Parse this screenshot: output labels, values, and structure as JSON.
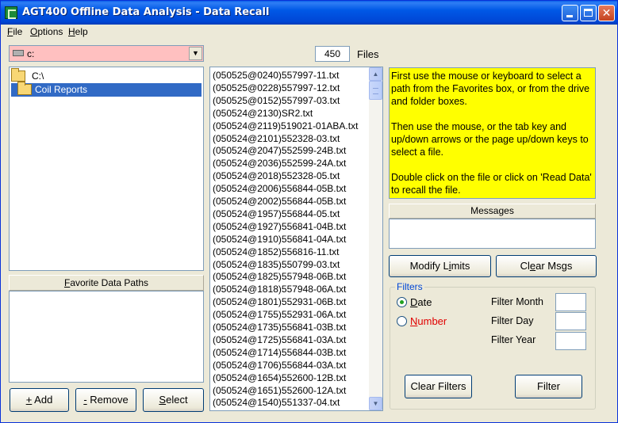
{
  "window": {
    "title": "AGT400 Offline Data Analysis  - Data Recall",
    "min_glyph": "",
    "max_glyph": "",
    "close_glyph": "✕"
  },
  "menu": [
    {
      "pre": "",
      "key": "F",
      "post": "ile"
    },
    {
      "pre": "",
      "key": "O",
      "post": "ptions"
    },
    {
      "pre": "",
      "key": "H",
      "post": "elp"
    }
  ],
  "drive": {
    "selected": "c:",
    "dropdown_arrow": "▼"
  },
  "folders": [
    {
      "label": "C:\\",
      "selected": false
    },
    {
      "label": "Coil Reports",
      "selected": true
    }
  ],
  "favorites": {
    "label_pre": "",
    "label_key": "F",
    "label_post": "avorite Data Paths"
  },
  "buttons": {
    "add": {
      "pre": "",
      "key": "+",
      "post": " Add"
    },
    "remove": {
      "pre": "",
      "key": "-",
      "post": " Remove"
    },
    "select": {
      "pre": "",
      "key": "S",
      "post": "elect"
    },
    "modify_limits": {
      "pre": "Modify L",
      "key": "i",
      "post": "mits"
    },
    "clear_msgs": {
      "pre": "Cl",
      "key": "e",
      "post": "ar Msgs"
    },
    "clear_filters": "Clear Filters",
    "filter": "Filter"
  },
  "file_count": "450",
  "files_label": "Files",
  "files": [
    "(050525@0240)557997-11.txt",
    "(050525@0228)557997-12.txt",
    "(050525@0152)557997-03.txt",
    "(050524@2130)SR2.txt",
    "(050524@2119)519021-01ABA.txt",
    "(050524@2101)552328-03.txt",
    "(050524@2047)552599-24B.txt",
    "(050524@2036)552599-24A.txt",
    "(050524@2018)552328-05.txt",
    "(050524@2006)556844-05B.txt",
    "(050524@2002)556844-05B.txt",
    "(050524@1957)556844-05.txt",
    "(050524@1927)556841-04B.txt",
    "(050524@1910)556841-04A.txt",
    "(050524@1852)556816-11.txt",
    "(050524@1835)550799-03.txt",
    "(050524@1825)557948-06B.txt",
    "(050524@1818)557948-06A.txt",
    "(050524@1801)552931-06B.txt",
    "(050524@1755)552931-06A.txt",
    "(050524@1735)556841-03B.txt",
    "(050524@1725)556841-03A.txt",
    "(050524@1714)556844-03B.txt",
    "(050524@1706)556844-03A.txt",
    "(050524@1654)552600-12B.txt",
    "(050524@1651)552600-12A.txt",
    "(050524@1540)551337-04.txt"
  ],
  "scroll": {
    "up": "▲",
    "down": "▼"
  },
  "instructions": [
    "First use the mouse or keyboard to select a path from the Favorites box, or from the drive and folder boxes.",
    "Then use the mouse, or the tab key and up/down arrows or the page up/down keys to select a file.",
    "Double click on the file or click on 'Read Data' to recall the file."
  ],
  "messages_label": "Messages",
  "filters": {
    "legend": "Filters",
    "date": {
      "pre": "",
      "key": "D",
      "post": "ate",
      "checked": true
    },
    "number": {
      "pre": "",
      "key": "N",
      "post": "umber",
      "checked": false
    },
    "month_label": "Filter Month",
    "day_label": "Filter Day",
    "year_label": "Filter Year"
  },
  "colors": {
    "title_bar": "#0058e6",
    "drive_combo_bg": "#ffc0c0",
    "instructions_bg": "#ffff00",
    "selection": "#316ac5",
    "number_label": "#e00000",
    "filters_legend": "#0046d5"
  }
}
